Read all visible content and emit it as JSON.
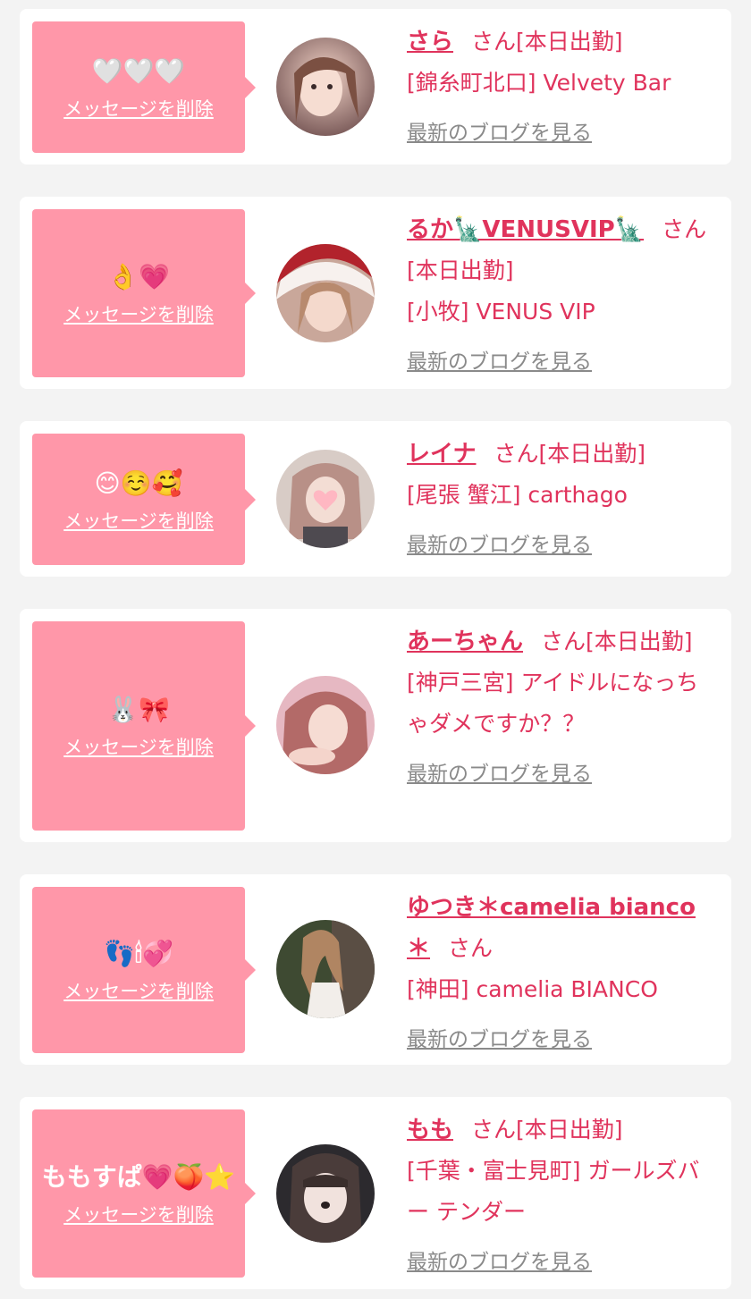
{
  "delete_label": "メッセージを削除",
  "blog_label": "最新のブログを見る",
  "colors": {
    "background": "#f3f3f3",
    "card": "#ffffff",
    "message_box": "#ff97a9",
    "accent": "#e0335c",
    "link_gray": "#8a8a8a"
  },
  "entries": [
    {
      "message": "🤍🤍🤍",
      "name": "さら",
      "suffix": "さん[本日出勤]",
      "shop": "[錦糸町北口] Velvety Bar",
      "avatar_icon": "profile-photo"
    },
    {
      "message": "👌💗",
      "name": "るか🗽VENUSVIP🗽",
      "suffix": "さん[本日出勤]",
      "shop": "[小牧] VENUS VIP",
      "avatar_icon": "profile-photo"
    },
    {
      "message": "😊☺️🥰",
      "name": "レイナ",
      "suffix": "さん[本日出勤]",
      "shop": "[尾張 蟹江] carthago",
      "avatar_icon": "profile-photo"
    },
    {
      "message": "🐰🎀",
      "name": "あーちゃん",
      "suffix": "さん[本日出勤]",
      "shop": "[神戸三宮] アイドルになっちゃダメですか？？",
      "avatar_icon": "profile-photo"
    },
    {
      "message": "👣🕯💞",
      "name": "ゆつき＊camelia bianco＊",
      "suffix": "さん",
      "shop": "[神田] camelia BIANCO",
      "avatar_icon": "profile-photo"
    },
    {
      "message": "ももすぱ💗🍑⭐",
      "name": "もも",
      "suffix": "さん[本日出勤]",
      "shop": "[千葉・富士見町] ガールズバー テンダー",
      "avatar_icon": "profile-photo"
    }
  ]
}
